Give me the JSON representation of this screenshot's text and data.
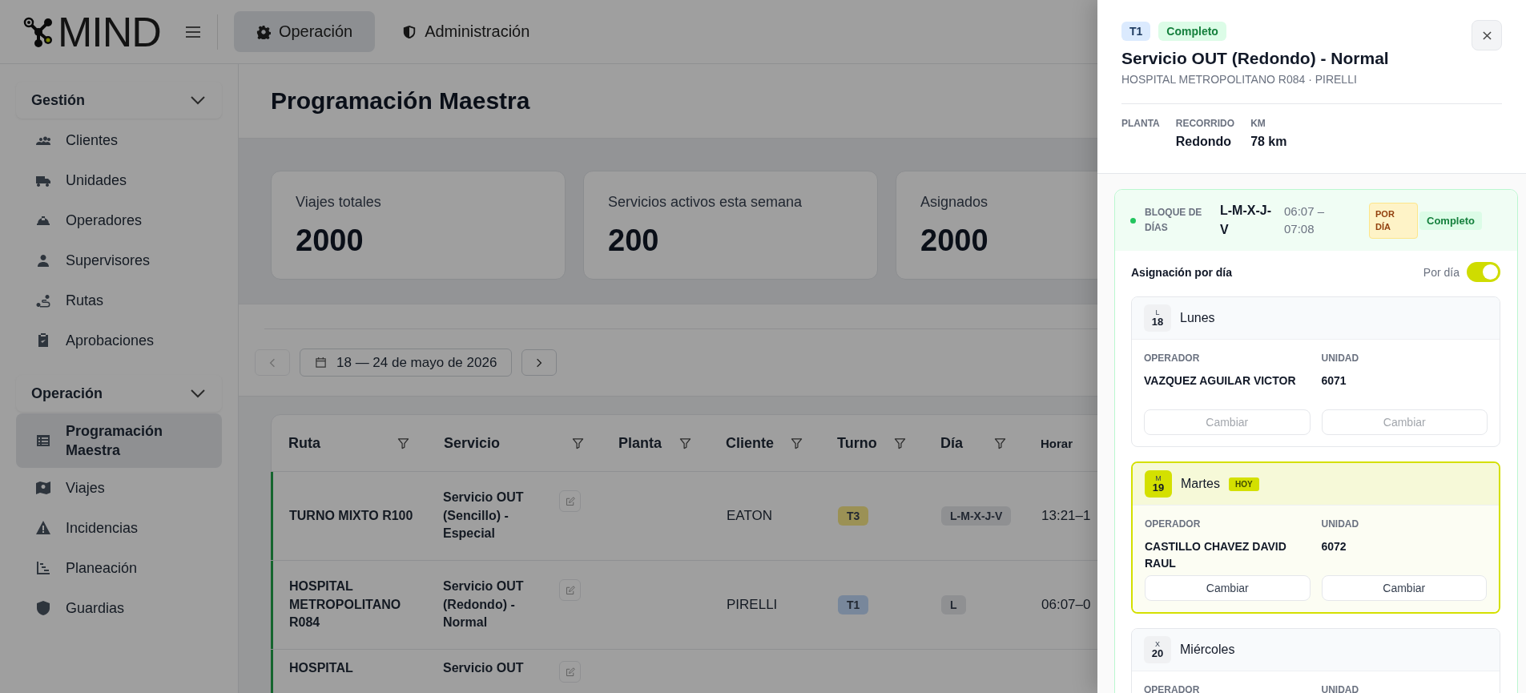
{
  "app": {
    "logo": "MIND"
  },
  "top_tabs": [
    {
      "label": "Operación",
      "selected": true
    },
    {
      "label": "Administración",
      "selected": false
    }
  ],
  "sidebar": {
    "groups": [
      {
        "title": "Gestión",
        "expanded": true,
        "items": [
          {
            "label": "Clientes",
            "selected": false
          },
          {
            "label": "Unidades",
            "selected": false
          },
          {
            "label": "Operadores",
            "selected": false
          },
          {
            "label": "Supervisores",
            "selected": false
          },
          {
            "label": "Rutas",
            "selected": false
          },
          {
            "label": "Aprobaciones",
            "selected": false
          }
        ]
      },
      {
        "title": "Operación",
        "expanded": true,
        "items": [
          {
            "label": "Programación Maestra",
            "selected": true
          },
          {
            "label": "Viajes",
            "selected": false
          },
          {
            "label": "Incidencias",
            "selected": false
          },
          {
            "label": "Planeación",
            "selected": false
          },
          {
            "label": "Guardias",
            "selected": false
          }
        ]
      }
    ]
  },
  "page": {
    "title": "Programación Maestra"
  },
  "stats": [
    {
      "label": "Viajes totales",
      "value": "2000"
    },
    {
      "label": "Servicios activos esta semana",
      "value": "200"
    },
    {
      "label": "Asignados",
      "value": "2000"
    }
  ],
  "date_nav": {
    "range": "18 — 24 de mayo de 2026",
    "prev_disabled": true
  },
  "table": {
    "columns": [
      {
        "label": "Ruta",
        "filter": true
      },
      {
        "label": "Servicio",
        "filter": true
      },
      {
        "label": "Planta",
        "filter": true
      },
      {
        "label": "Cliente",
        "filter": true
      },
      {
        "label": "Turno",
        "filter": true
      },
      {
        "label": "Día",
        "filter": true
      },
      {
        "label": "Horar",
        "filter": false
      }
    ],
    "rows": [
      {
        "ruta": "TURNO MIXTO R100",
        "servicio": "Servicio OUT (Sencillo) - Especial",
        "cliente": "EATON",
        "turno": {
          "label": "T3",
          "color": "#9b9155"
        },
        "dia": "L-M-X-J-V",
        "horario": "13:21–1"
      },
      {
        "ruta": "HOSPITAL METROPOLITANO R084",
        "servicio": "Servicio OUT (Redondo) - Normal",
        "cliente": "PIRELLI",
        "turno": {
          "label": "T1",
          "color": "#78879b"
        },
        "dia": "L",
        "horario": "06:07–0"
      },
      {
        "ruta": "HOSPITAL",
        "servicio": "Servicio OUT"
      }
    ]
  },
  "detail": {
    "turno": "T1",
    "status": "Completo",
    "title": "Servicio OUT (Redondo) - Normal",
    "subtitle": "HOSPITAL METROPOLITANO R084 · PIRELLI",
    "meta": [
      {
        "label": "PLANTA"
      },
      {
        "label": "RECORRIDO",
        "value": "Redondo"
      },
      {
        "label": "KM",
        "value": "78 km"
      }
    ],
    "block": {
      "label": "BLOQUE DE DÍAS",
      "days": "L-M-X-J-V",
      "time": "06:07 – 07:08",
      "mode": "POR DÍA",
      "status": "Completo",
      "assign_title": "Asignación por día",
      "toggle_label": "Por día",
      "toggle_on": true,
      "day_cards": [
        {
          "abbr": "L",
          "num": "18",
          "name": "Lunes",
          "today": false,
          "fields": [
            {
              "label": "OPERADOR",
              "value": "VAZQUEZ AGUILAR VICTOR"
            },
            {
              "label": "UNIDAD",
              "value": "6071"
            }
          ],
          "buttons": [
            {
              "label": "Cambiar",
              "disabled": true
            },
            {
              "label": "Cambiar",
              "disabled": true
            }
          ]
        },
        {
          "abbr": "M",
          "num": "19",
          "name": "Martes",
          "today": true,
          "badge": "HOY",
          "fields": [
            {
              "label": "OPERADOR",
              "value": "CASTILLO CHAVEZ DAVID RAUL"
            },
            {
              "label": "UNIDAD",
              "value": "6072"
            }
          ],
          "buttons": [
            {
              "label": "Cambiar",
              "disabled": false
            },
            {
              "label": "Cambiar",
              "disabled": false
            }
          ]
        },
        {
          "abbr": "X",
          "num": "20",
          "name": "Miércoles",
          "today": false,
          "fields": [
            {
              "label": "OPERADOR"
            },
            {
              "label": "UNIDAD"
            }
          ]
        }
      ]
    }
  }
}
